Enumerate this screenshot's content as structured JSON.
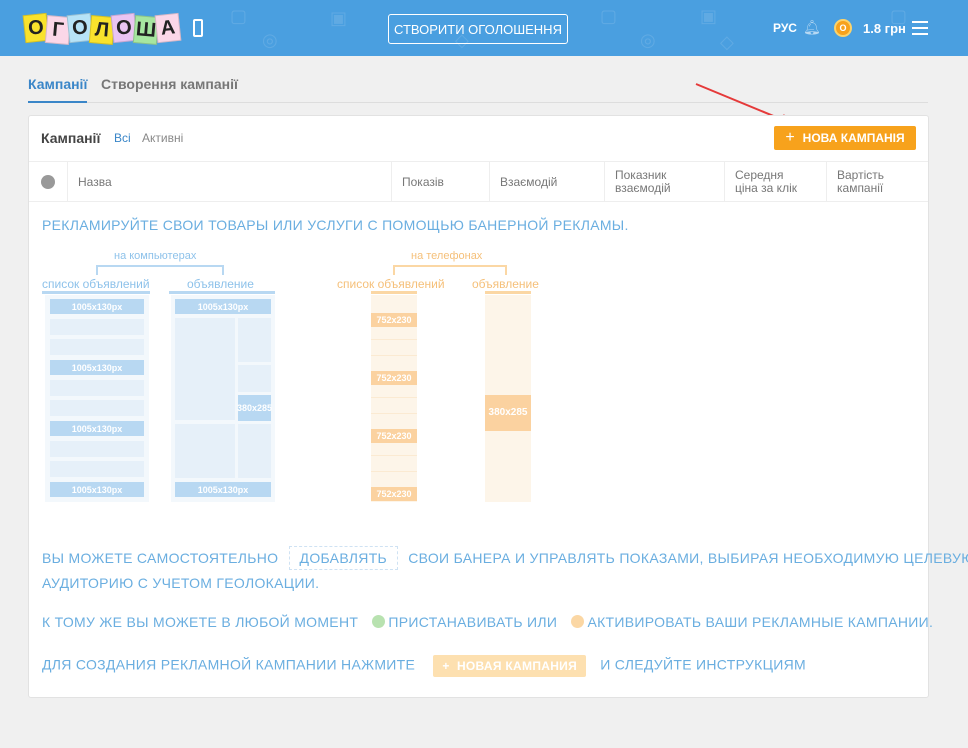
{
  "header": {
    "logo_letters": [
      "О",
      "Г",
      "О",
      "Л",
      "О",
      "Ш",
      "А"
    ],
    "logo_colors": [
      "#f9e22c",
      "#fbd7e8",
      "#b7e3f7",
      "#f9e22c",
      "#e9c4f2",
      "#a6e6a0",
      "#fbd7e8"
    ],
    "create_button": "СТВОРИТИ ОГОЛОШЕННЯ",
    "language": "РУС",
    "coin_letter": "О",
    "balance": "1.8 грн",
    "icons": [
      "phone-icon",
      "bell-icon",
      "coin-icon",
      "menu-icon"
    ]
  },
  "tabs": [
    {
      "label": "Кампанії",
      "active": true
    },
    {
      "label": "Створення кампанії",
      "active": false
    }
  ],
  "card": {
    "title": "Кампанії",
    "filter_all": "Всі",
    "filter_active": "Активні",
    "new_button": "НОВА КАМПАНІЯ",
    "columns": [
      "Назва",
      "Показів",
      "Взаємодій",
      "Показник взаємодій",
      "Середня ціна за клік",
      "Вартість кампанії"
    ]
  },
  "promo": {
    "headline": "РЕКЛАМИРУЙТЕ СВОИ ТОВАРЫ ИЛИ УСЛУГИ С ПОМОЩЬЮ БАНЕРНОЙ РЕКЛАМЫ.",
    "desktop_group": "на компьютерах",
    "mobile_group": "на телефонах",
    "list_label": "список объявлений",
    "ad_label": "объявление",
    "desktop_banner": "1005x130px",
    "mobile_banner": "752x230",
    "square_size": [
      "380",
      "x",
      "285"
    ],
    "line1_before": "ВЫ МОЖЕТЕ САМОСТОЯТЕЛЬНО",
    "line1_box": "ДОБАВЛЯТЬ",
    "line1_after": "СВОИ БАНЕРА И УПРАВЛЯТЬ ПОКАЗАМИ, ВЫБИРАЯ НЕОБХОДИМУЮ ЦЕЛЕВУЮ",
    "line1_cont": "АУДИТОРИЮ С УЧЕТОМ ГЕОЛОКАЦИИ.",
    "line2_before": "К ТОМУ ЖЕ ВЫ МОЖЕТЕ В ЛЮБОЙ МОМЕНТ",
    "line2_pause": "ПРИСТАНАВИВАТЬ ИЛИ",
    "line2_activate": "АКТИВИРОВАТЬ ВАШИ РЕКЛАМНЫЕ КАМПАНИИ.",
    "line3_before": "ДЛЯ СОЗДАНИЯ РЕКЛАМНОЙ КАМПАНИИ НАЖМИТЕ",
    "line3_button": "НОВАЯ КАМПАНИЯ",
    "line3_after": "И СЛЕДУЙТЕ ИНСТРУКЦИЯМ"
  },
  "colors": {
    "header_bg": "#4a9fe0",
    "accent": "#3a86c8",
    "orange": "#f7a21c",
    "promo_text": "#6aaee0"
  }
}
